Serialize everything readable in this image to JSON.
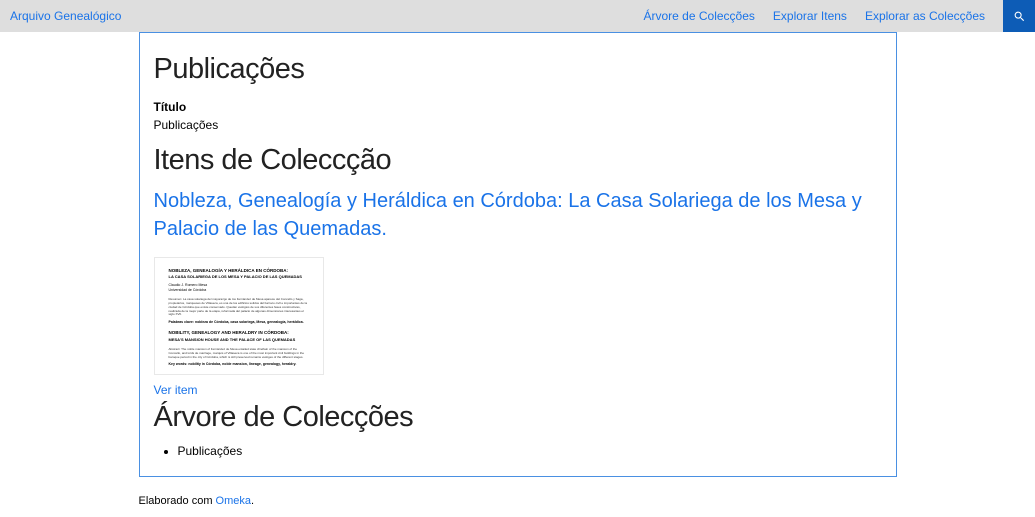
{
  "header": {
    "site_title": "Arquivo Genealógico",
    "nav": [
      {
        "label": "Árvore de Colecções"
      },
      {
        "label": "Explorar Itens"
      },
      {
        "label": "Explorar as Colecções"
      }
    ]
  },
  "page": {
    "title": "Publicações",
    "meta_label": "Título",
    "meta_value": "Publicações"
  },
  "items_section": {
    "heading": "Itens de Coleccção",
    "item_title": "Nobleza, Genealogía y Heráldica en Córdoba: La Casa Solariega de los Mesa y Palacio de las Quemadas.",
    "view_item": "Ver item"
  },
  "thumbnail": {
    "t1": "NOBLEZA, GENEALOGÍA Y HERÁLDICA EN CÓRDOBA:",
    "t2": "LA CASA SOLARIEGA DE LOS MESA Y PALACIO DE LAS QUEMADAS",
    "auth1": "Claudio J. Romero Mesa",
    "auth2": "Universidad de Córdoba",
    "abs_es": "Resumen: La casa solariega del mayorazgo de los Fernández de Mesa aparece del Concello y Saga, propietarios, marqueses de Villaseca, es una de los edificios solidos del barroco civil e importantes de la ciudad de Córdoba que existe conservado. Quedan vestigios de sus diferentes fases constructivas, realizada de la mejor parte de la etapa, reformada del palacio de algunas dimensiones interesantes el siglo XVII.",
    "kw_es": "Palabras clave: nobleza de Córdoba, casa solariega, Mesa, genealogía, heráldica.",
    "t3": "NOBILITY, GENEALOGY AND HERALDRY IN CÓRDOBA:",
    "t4": "MESA'S MANSION HOUSE AND THE PALACE OF LAS QUEMADAS",
    "abs_en": "Abstract: The noble mansion of Fernández de Mesa entailed state chieftain of the mansion of the Concello, and lords de marriage, marquis of Villaseca is one of the most important civil buildings in the baroque period in the city of Córdoba, which is still preserved remains vestiges of the different stages.",
    "kw_en": "Key words: nobility in Córdoba, noble mansion, lineage, genealogy, heraldry."
  },
  "tree": {
    "heading": "Árvore de Colecções",
    "items": [
      "Publicações"
    ]
  },
  "footer": {
    "prefix": "Elaborado com ",
    "link": "Omeka",
    "suffix": "."
  }
}
